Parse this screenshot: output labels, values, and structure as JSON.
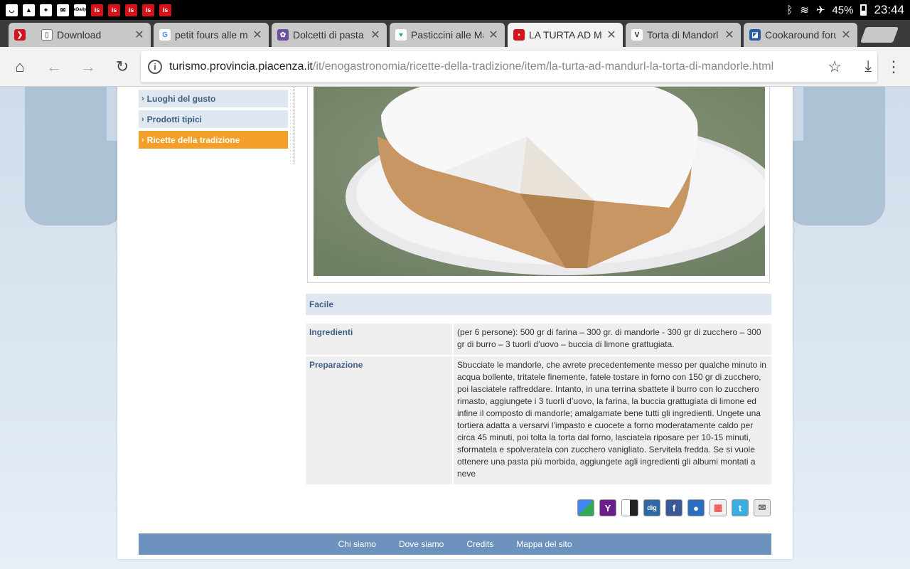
{
  "status_bar": {
    "battery": "45%",
    "time": "23:44",
    "notif_icons": [
      "notification-icon",
      "gallery-icon",
      "location-icon",
      "email-icon",
      "deals-icon",
      "news-icon",
      "news-icon",
      "news-icon",
      "news-icon",
      "news-icon"
    ],
    "deals_label": "eDaily",
    "news_label": "is"
  },
  "tabs": [
    {
      "title": "",
      "icon": "brand-icon",
      "color": "#d5121b"
    },
    {
      "title": "Download",
      "icon": "file-icon",
      "color": "#777777"
    },
    {
      "title": "petit fours alle m",
      "icon": "google-icon",
      "color": "#4285f4"
    },
    {
      "title": "Dolcetti di pasta",
      "icon": "site-icon",
      "color": "#6b4fa0"
    },
    {
      "title": "Pasticcini alle Ma",
      "icon": "heart-icon",
      "color": "#2aa6a0"
    },
    {
      "title": "LA TURTA AD MA",
      "icon": "site-icon",
      "color": "#d5121b",
      "active": true
    },
    {
      "title": "Torta di Mandorl",
      "icon": "site-icon",
      "color": "#222222",
      "fav_text": "V"
    },
    {
      "title": "Cookaround foru",
      "icon": "site-icon",
      "color": "#2a5d9f"
    }
  ],
  "toolbar": {
    "url_host": "turismo.provincia.piacenza.it",
    "url_path": "/it/enogastronomia/ricette-della-tradizione/item/la-turta-ad-mandurl-la-torta-di-mandorle.html"
  },
  "nav": {
    "items": [
      {
        "label": "Luoghi del gusto",
        "active": false
      },
      {
        "label": "Prodotti tipici",
        "active": false
      },
      {
        "label": "Ricette della tradizione",
        "active": true
      }
    ]
  },
  "recipe": {
    "difficulty": "Facile",
    "rows": [
      {
        "label": "Ingredienti",
        "value": "(per 6 persone): 500 gr di farina – 300 gr. di mandorle - 300 gr di zucchero – 300 gr di burro – 3 tuorli d’uovo – buccia di limone grattugiata."
      },
      {
        "label": "Preparazione",
        "value": "Sbucciate le mandorle, che avrete precedentemente messo per qualche minuto in acqua bollente, tritatele finemente, fatele tostare in forno con 150 gr di zucchero, poi lasciatele raffreddare. Intanto, in una terrina sbattete il burro con lo zucchero rimasto, aggiungete i 3 tuorli d’uovo, la farina, la buccia grattugiata di limone ed infine il composto di mandorle; amalgamate bene tutti gli ingredienti. Ungete una tortiera adatta a versarvi l’impasto e cuocete a forno moderatamente caldo per circa 45 minuti, poi tolta la torta dal forno, lasciatela riposare per 10-15 minuti, sformatela e spolveratela con zucchero vanigliato. Servitela fredda. Se si vuole ottenere una pasta più morbida, aggiungete agli ingredienti gli albumi montati a neve"
      }
    ]
  },
  "share": [
    {
      "name": "google-share-icon",
      "glyph": "",
      "color": "#4caf50"
    },
    {
      "name": "yahoo-share-icon",
      "glyph": "Y",
      "color": "#6b1f8c"
    },
    {
      "name": "delicious-share-icon",
      "glyph": "",
      "color": "#222222"
    },
    {
      "name": "digg-share-icon",
      "glyph": "dig",
      "color": "#2d6aa3"
    },
    {
      "name": "facebook-share-icon",
      "glyph": "f",
      "color": "#3b5998"
    },
    {
      "name": "myspace-share-icon",
      "glyph": "",
      "color": "#2a6fbf"
    },
    {
      "name": "windows-live-share-icon",
      "glyph": "",
      "color": "#f0f0f0"
    },
    {
      "name": "twitter-share-icon",
      "glyph": "t",
      "color": "#3aaee3"
    },
    {
      "name": "email-share-icon",
      "glyph": "✉",
      "color": "#e8e8e8"
    }
  ],
  "footer": {
    "links": [
      "Chi siamo",
      "Dove siamo",
      "Credits",
      "Mappa del sito"
    ]
  }
}
